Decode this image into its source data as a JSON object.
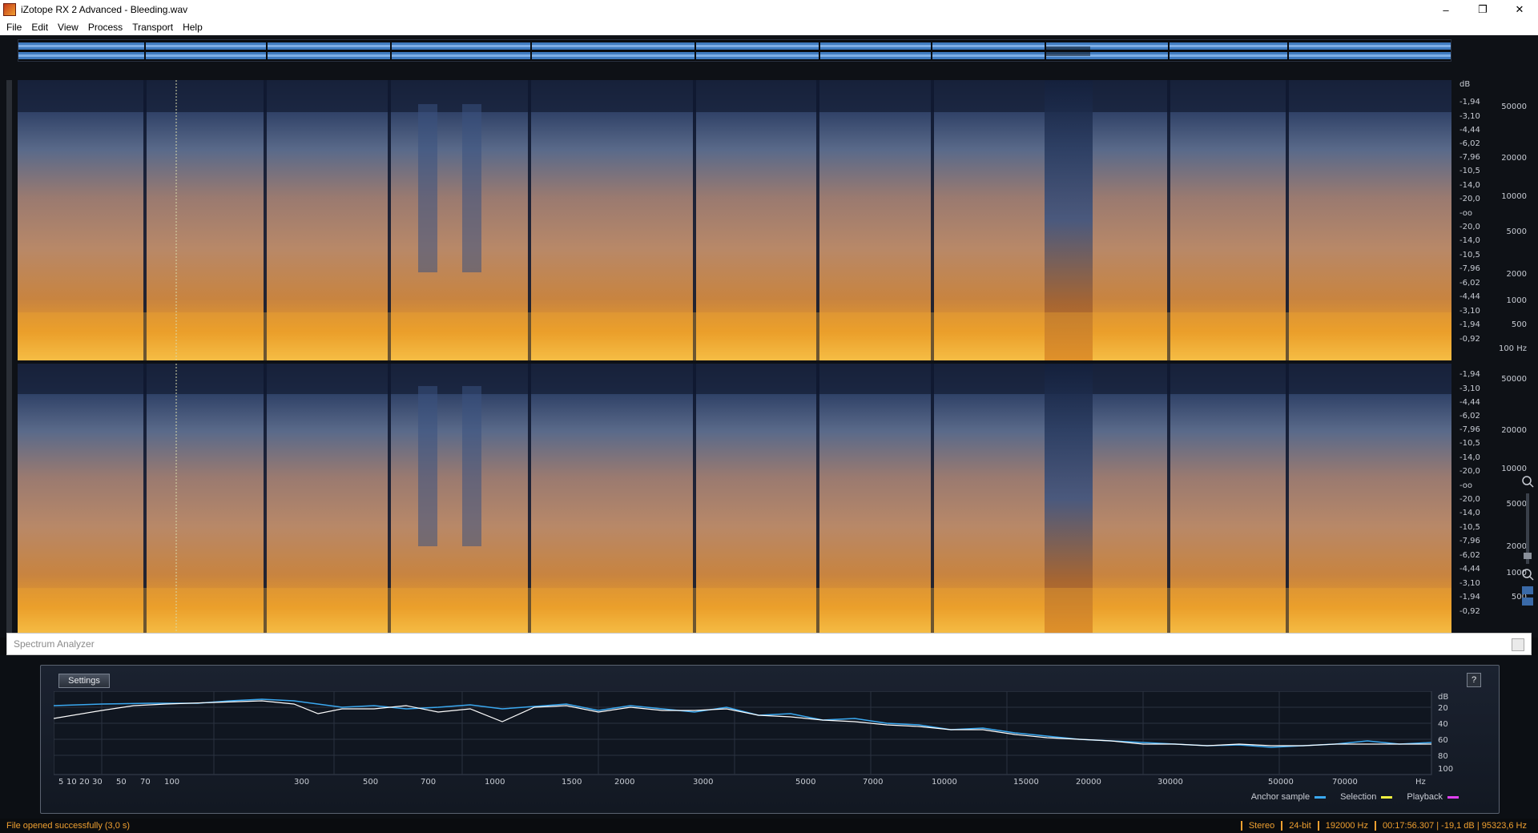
{
  "window": {
    "title": "iZotope RX 2 Advanced - Bleeding.wav",
    "controls": [
      "–",
      "❐",
      "✕"
    ]
  },
  "menu": [
    "File",
    "Edit",
    "View",
    "Process",
    "Transport",
    "Help"
  ],
  "spectrogram": {
    "db_scale_label": "dB",
    "db_ticks": [
      "-1,94",
      "-3,10",
      "-4,44",
      "-6,02",
      "-7,96",
      "-10,5",
      "-14,0",
      "-20,0",
      "-oo",
      "-20,0",
      "-14,0",
      "-10,5",
      "-7,96",
      "-6,02",
      "-4,44",
      "-3,10",
      "-1,94",
      "-0,92"
    ],
    "hz_ticks_ch1": [
      "50000",
      "20000",
      "10000",
      "5000",
      "2000",
      "1000",
      "500",
      "100 Hz"
    ],
    "hz_ticks_ch2": [
      "50000",
      "20000",
      "10000",
      "5000",
      "2000",
      "1000",
      "500"
    ]
  },
  "spectrum_analyzer": {
    "title": "Spectrum Analyzer",
    "settings_label": "Settings",
    "help_label": "?",
    "freq_labels": [
      "5",
      "10",
      "20",
      "30",
      "50",
      "70",
      "100",
      "300",
      "500",
      "700",
      "1000",
      "1500",
      "2000",
      "3000",
      "5000",
      "7000",
      "10000",
      "15000",
      "20000",
      "30000",
      "50000",
      "70000",
      "Hz"
    ],
    "db_labels": [
      "dB",
      "20",
      "40",
      "60",
      "80",
      "100"
    ],
    "legend": [
      {
        "label": "Anchor sample",
        "color": "#3aa8f0"
      },
      {
        "label": "Selection",
        "color": "#f0f040"
      },
      {
        "label": "Playback",
        "color": "#e040f0"
      }
    ]
  },
  "status": {
    "message": "File opened successfully (3,0 s)",
    "segments": [
      "Stereo",
      "24-bit",
      "192000 Hz",
      "00:17:56.307 | -19,1 dB | 95323,6 Hz"
    ]
  },
  "colors": {
    "accent": "#f0a030",
    "waveform": "#5aa8ff",
    "anchor_curve": "#3aa8f0",
    "playback_curve": "#ffffff"
  }
}
